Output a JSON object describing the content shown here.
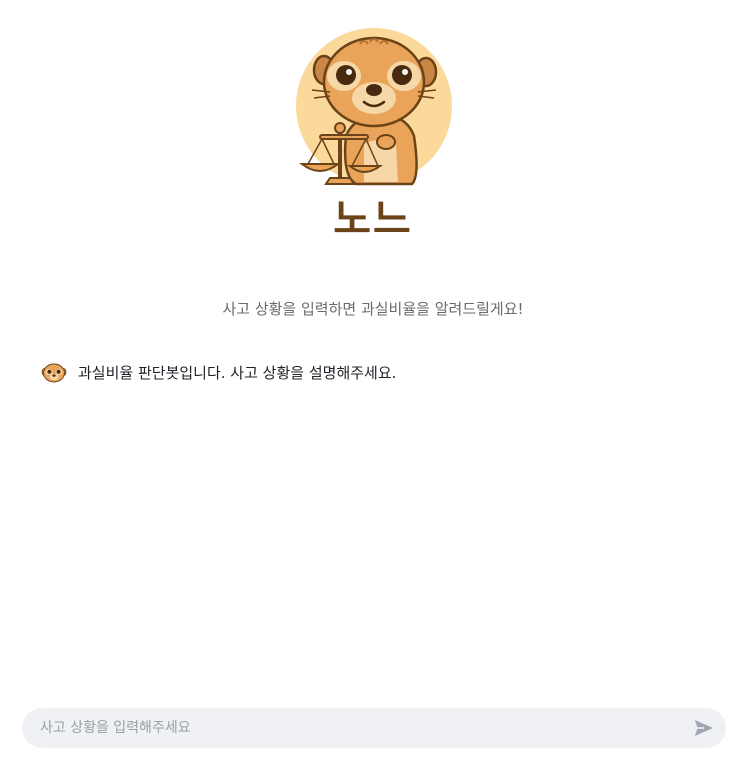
{
  "header": {
    "app_title": "노느",
    "subtitle": "사고 상황을 입력하면 과실비율을 알려드릴게요!"
  },
  "chat": {
    "messages": [
      {
        "sender": "bot",
        "text": "과실비율 판단봇입니다. 사고 상황을 설명해주세요."
      }
    ]
  },
  "composer": {
    "placeholder": "사고 상황을 입력해주세요",
    "value": ""
  },
  "icons": {
    "mascot": "meerkat-judge-icon",
    "bot_avatar": "meerkat-avatar-icon",
    "send": "send-icon"
  },
  "colors": {
    "title": "#6b4318",
    "mascot_circle": "#fbd99a",
    "input_background": "#eff1f5",
    "send_icon": "#a0a6b2"
  }
}
